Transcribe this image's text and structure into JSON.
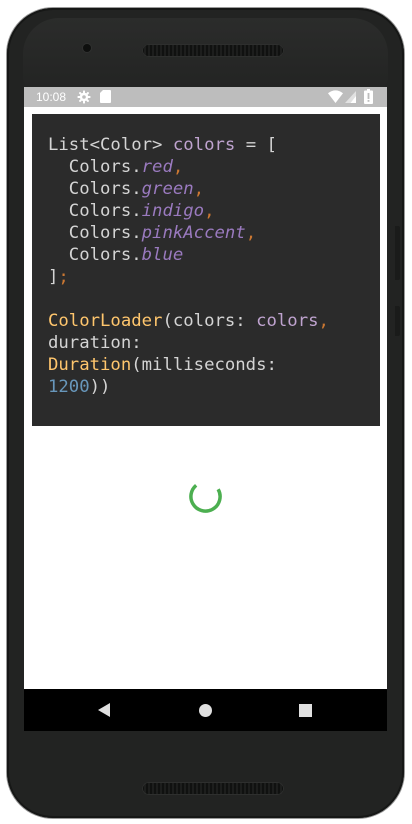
{
  "status_bar": {
    "time": "10:08",
    "icons": [
      "gear-icon",
      "sd-card-icon",
      "wifi-icon",
      "signal-icon",
      "battery-icon"
    ],
    "background": "#bdbdbd"
  },
  "code": {
    "lines": [
      [
        {
          "text": "List<Color> ",
          "role": "plain"
        },
        {
          "text": "colors",
          "role": "kw"
        },
        {
          "text": " = [",
          "role": "plain"
        }
      ],
      [
        {
          "text": "  Colors.",
          "role": "plain"
        },
        {
          "text": "red",
          "role": "id"
        },
        {
          "text": ",",
          "role": "comma"
        }
      ],
      [
        {
          "text": "  Colors.",
          "role": "plain"
        },
        {
          "text": "green",
          "role": "id"
        },
        {
          "text": ",",
          "role": "comma"
        }
      ],
      [
        {
          "text": "  Colors.",
          "role": "plain"
        },
        {
          "text": "indigo",
          "role": "id"
        },
        {
          "text": ",",
          "role": "comma"
        }
      ],
      [
        {
          "text": "  Colors.",
          "role": "plain"
        },
        {
          "text": "pinkAccent",
          "role": "id"
        },
        {
          "text": ",",
          "role": "comma"
        }
      ],
      [
        {
          "text": "  Colors.",
          "role": "plain"
        },
        {
          "text": "blue",
          "role": "id"
        }
      ],
      [
        {
          "text": "]",
          "role": "plain"
        },
        {
          "text": ";",
          "role": "semi"
        }
      ],
      [],
      [
        {
          "text": "ColorLoader",
          "role": "cls"
        },
        {
          "text": "(colors: ",
          "role": "plain"
        },
        {
          "text": "colors",
          "role": "kw"
        },
        {
          "text": ",",
          "role": "comma"
        }
      ],
      [
        {
          "text": "duration:",
          "role": "plain"
        }
      ],
      [
        {
          "text": "Duration",
          "role": "cls"
        },
        {
          "text": "(milliseconds:",
          "role": "plain"
        }
      ],
      [
        {
          "text": "1200",
          "role": "num"
        },
        {
          "text": "))",
          "role": "plain"
        }
      ]
    ],
    "background": "#2b2b2b"
  },
  "loader": {
    "color": "#4caf50",
    "icon": "progress-spinner"
  },
  "nav_bar": {
    "icons": [
      "back-icon",
      "home-icon",
      "recents-icon"
    ],
    "background": "#000000"
  },
  "device": {
    "frame_color": "#222322"
  }
}
